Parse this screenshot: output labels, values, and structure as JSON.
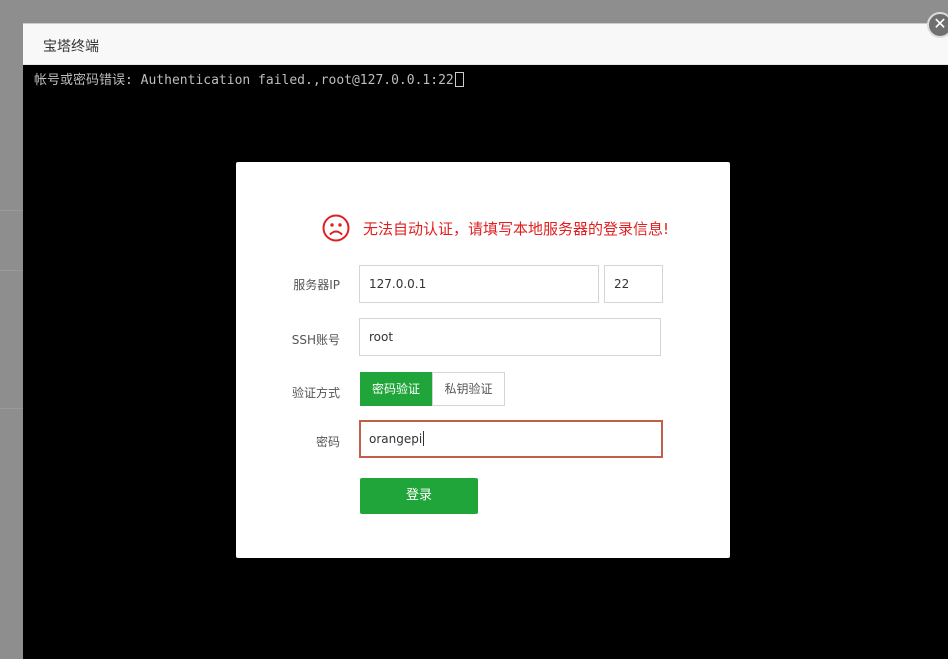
{
  "window": {
    "title": "宝塔终端",
    "close_icon": "close-icon"
  },
  "terminal": {
    "message": "帐号或密码错误: Authentication failed.,root@127.0.0.1:22"
  },
  "login_panel": {
    "warning_icon": "sad-face-icon",
    "warning_text": "无法自动认证，请填写本地服务器的登录信息!",
    "server_ip_label": "服务器IP",
    "server_ip_value": "127.0.0.1",
    "port_value": "22",
    "ssh_account_label": "SSH账号",
    "ssh_account_value": "root",
    "auth_method_label": "验证方式",
    "auth_methods": [
      "密码验证",
      "私钥验证"
    ],
    "password_label": "密码",
    "password_value": "orangepi",
    "login_button": "登录"
  },
  "colors": {
    "accent_green": "#20a53a",
    "warning_red": "#e02020",
    "terminal_bg": "#000000"
  }
}
